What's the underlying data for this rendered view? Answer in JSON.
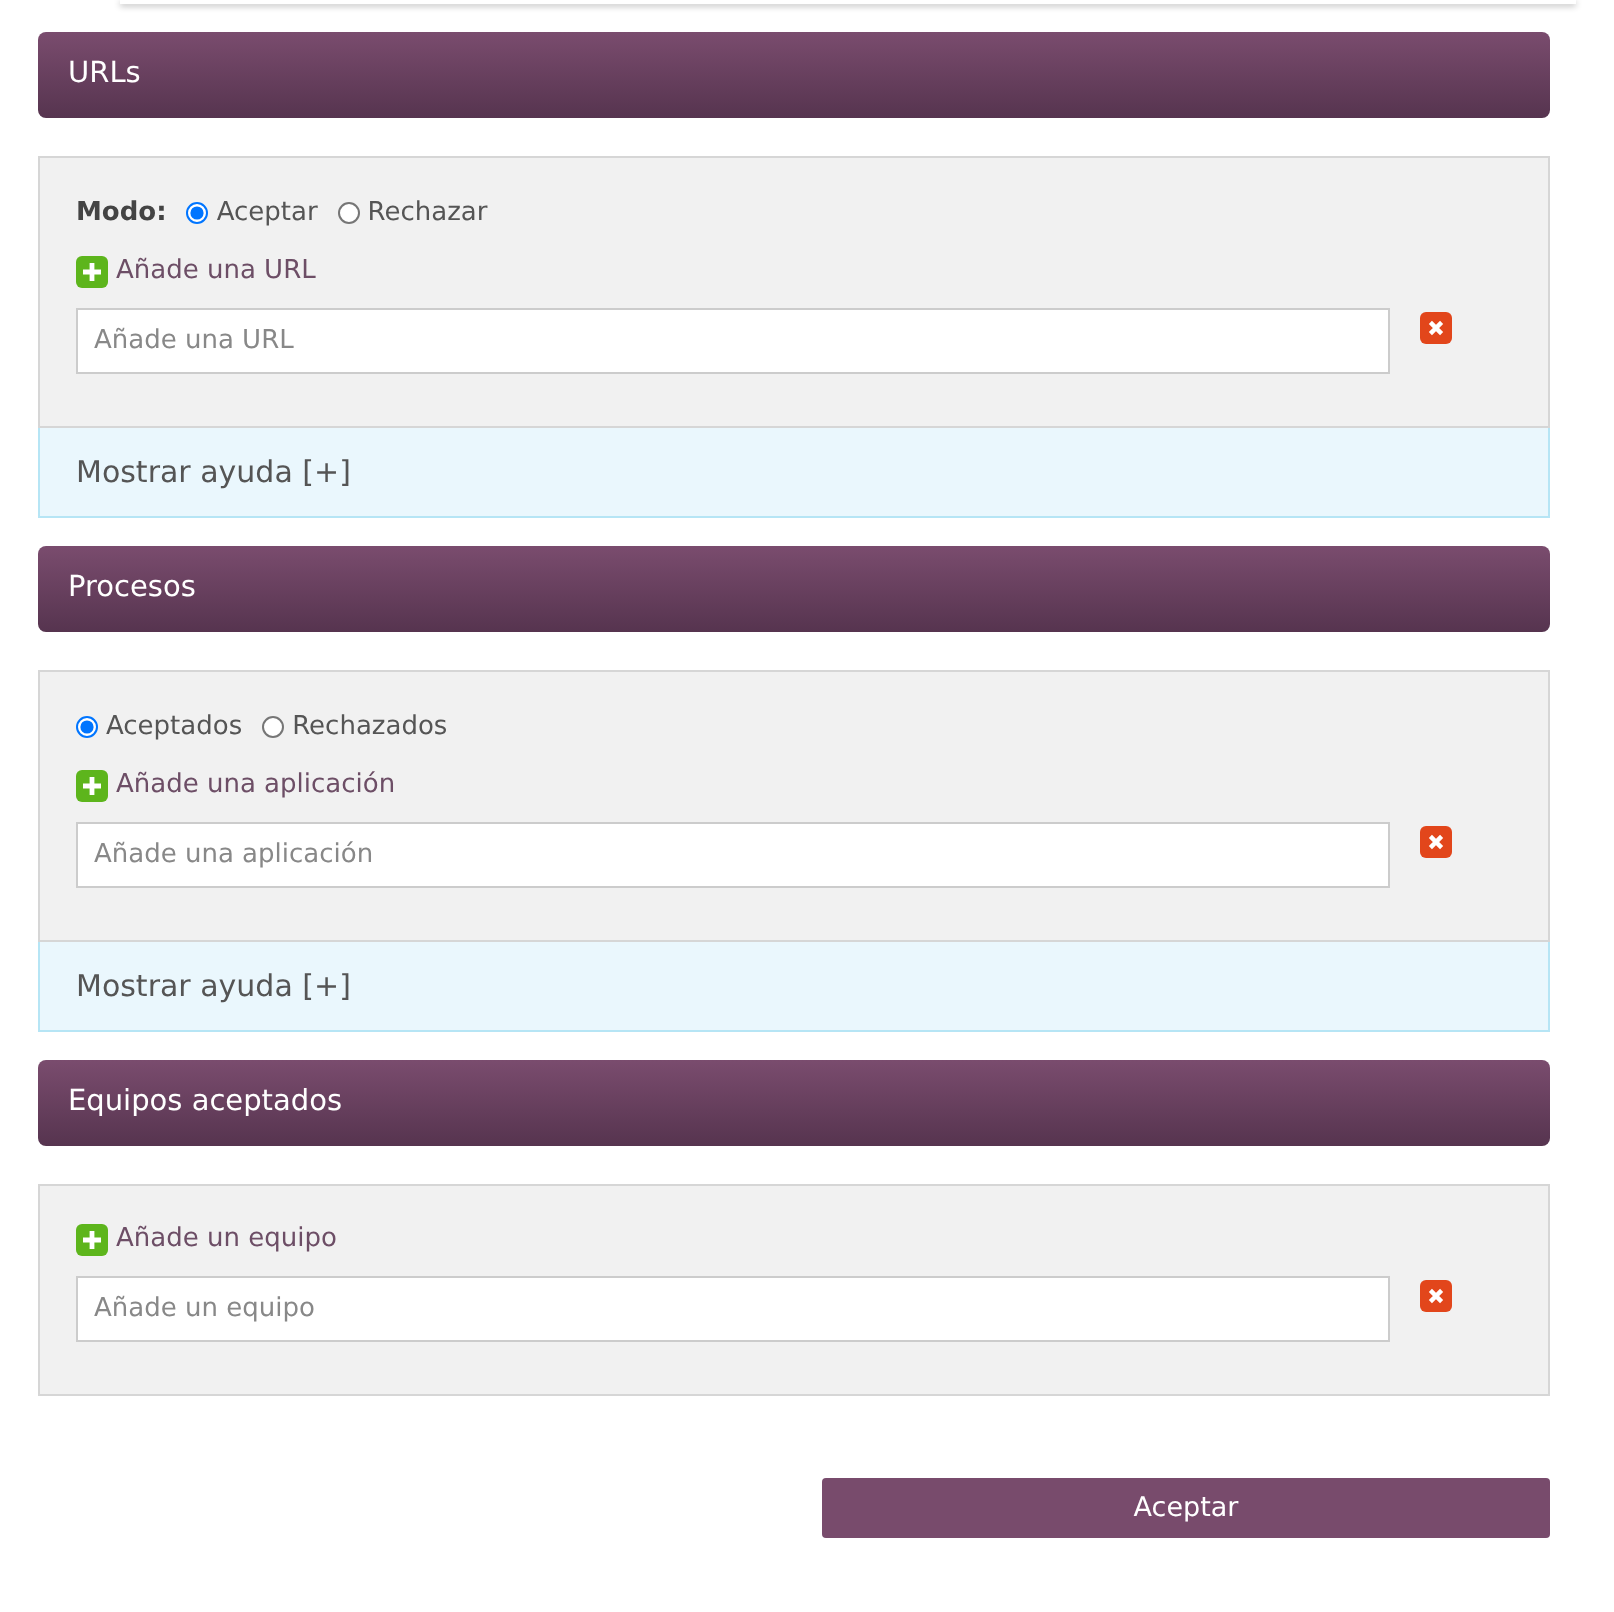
{
  "sections": [
    {
      "title": "URLs",
      "mode_label": "Modo:",
      "options": [
        {
          "label": "Aceptar",
          "selected": true
        },
        {
          "label": "Rechazar",
          "selected": false
        }
      ],
      "add_link": "Añade una URL",
      "input": {
        "placeholder": "Añade una URL"
      },
      "help": "Mostrar ayuda [+]"
    },
    {
      "title": "Procesos",
      "options": [
        {
          "label": "Aceptados",
          "selected": true
        },
        {
          "label": "Rechazados",
          "selected": false
        }
      ],
      "add_link": "Añade una aplicación",
      "input": {
        "placeholder": "Añade una aplicación"
      },
      "help": "Mostrar ayuda [+]"
    },
    {
      "title": "Equipos aceptados",
      "add_link": "Añade un equipo",
      "input": {
        "placeholder": "Añade un equipo"
      }
    }
  ],
  "submit": "Aceptar"
}
